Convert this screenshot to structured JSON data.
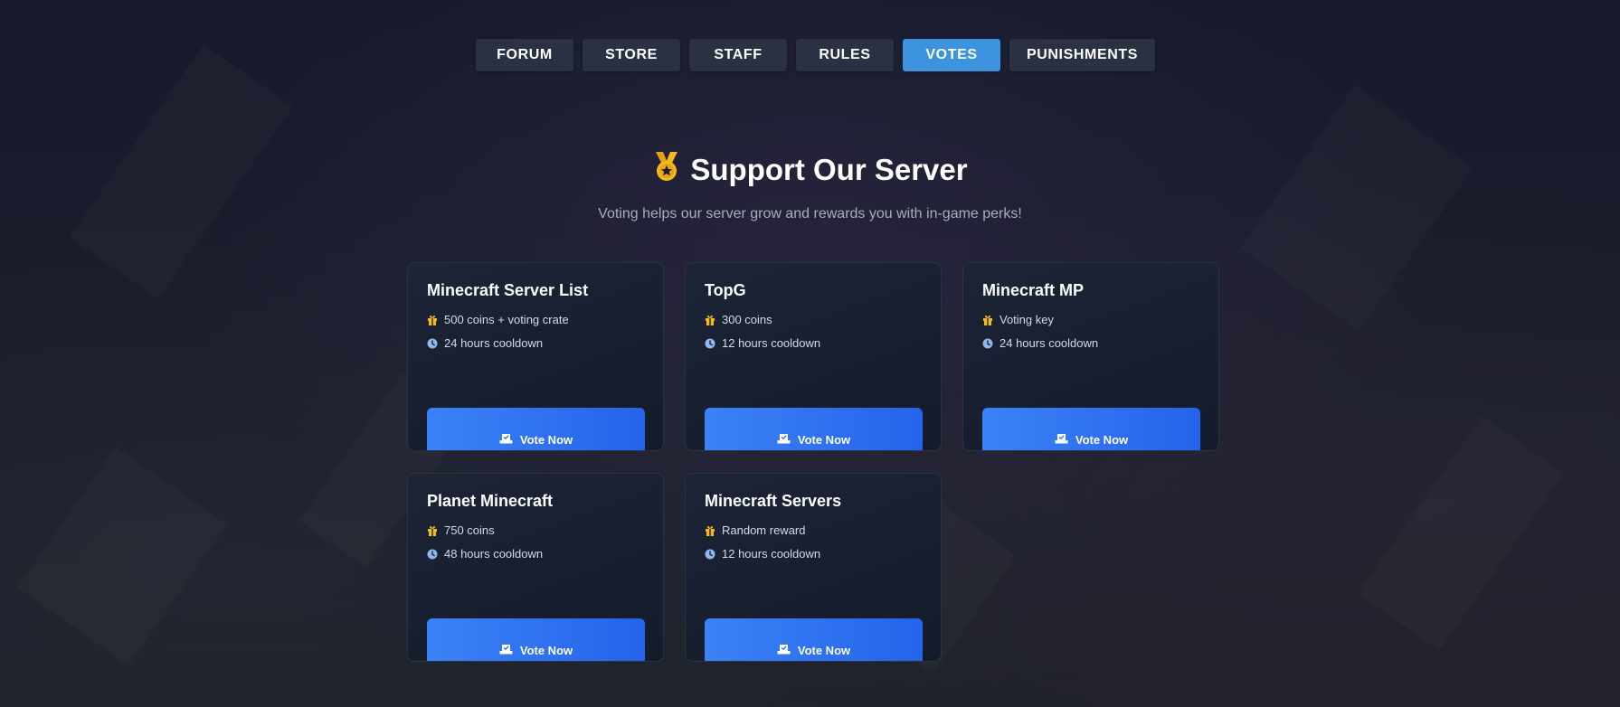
{
  "nav": {
    "items": [
      {
        "label": "FORUM"
      },
      {
        "label": "STORE"
      },
      {
        "label": "STAFF"
      },
      {
        "label": "RULES"
      },
      {
        "label": "VOTES",
        "active": true
      },
      {
        "label": "PUNISHMENTS"
      }
    ]
  },
  "header": {
    "icon": "medal-icon",
    "title": "Support Our Server",
    "subtitle": "Voting helps our server grow and rewards you with in-game perks!"
  },
  "cards": [
    {
      "title": "Minecraft Server List",
      "reward": "500 coins + voting crate",
      "cooldown": "24 hours cooldown",
      "button": "Vote Now"
    },
    {
      "title": "TopG",
      "reward": "300 coins",
      "cooldown": "12 hours cooldown",
      "button": "Vote Now"
    },
    {
      "title": "Minecraft MP",
      "reward": "Voting key",
      "cooldown": "24 hours cooldown",
      "button": "Vote Now"
    },
    {
      "title": "Planet Minecraft",
      "reward": "750 coins",
      "cooldown": "48 hours cooldown",
      "button": "Vote Now"
    },
    {
      "title": "Minecraft Servers",
      "reward": "Random reward",
      "cooldown": "12 hours cooldown",
      "button": "Vote Now"
    }
  ],
  "icons": {
    "reward": "gift-icon",
    "cooldown": "clock-icon",
    "vote": "vote-box-icon"
  },
  "colors": {
    "accent": "#3d93dd",
    "button_gradient_start": "#3b82f6",
    "button_gradient_end": "#2563eb",
    "gift": "#f5b81f",
    "clock": "#8fb8f0"
  }
}
